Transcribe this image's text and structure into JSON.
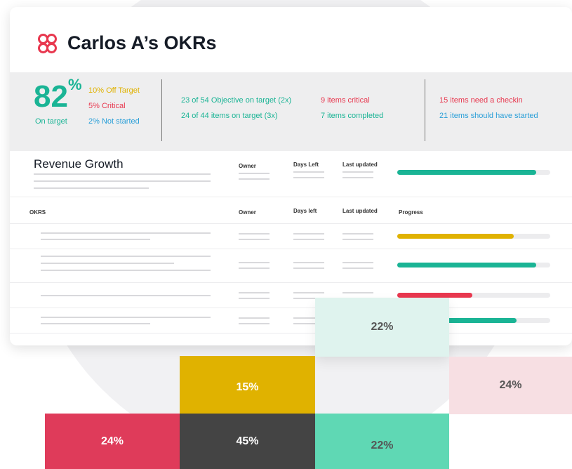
{
  "header": {
    "title": "Carlos A’s OKRs"
  },
  "summary": {
    "percent": "82",
    "percent_sign": "%",
    "on_target_label": "On target",
    "off_target": "10% Off Target",
    "critical": "5% Critical",
    "not_started": "2% Not started",
    "objectives_line": "23 of 54 Objective on target (2x)",
    "items_line": "24 of 44 items on target (3x)",
    "items_critical": "9 items critical",
    "items_completed": "7 items completed",
    "need_checkin": "15 items need a checkin",
    "should_started": "21  items should have started"
  },
  "section": {
    "title": "Revenue Growth",
    "owner": "Owner",
    "days_left": "Days Left",
    "last_updated": "Last updated",
    "progress": 0.91
  },
  "table": {
    "headers": {
      "okrs": "OKRS",
      "owner": "Owner",
      "days_left": "Days left",
      "last_updated": "Last updated",
      "progress": "Progress"
    },
    "rows": [
      {
        "progress": 0.76,
        "color": "#e0b200"
      },
      {
        "progress": 0.91,
        "color": "#1ab495"
      },
      {
        "progress": 0.49,
        "color": "#e8384f"
      },
      {
        "progress": 0.78,
        "color": "#1ab495"
      }
    ]
  },
  "tiles": {
    "mint_top": "22%",
    "yellow": "15%",
    "pink": "24%",
    "red": "24%",
    "dark": "45%",
    "green": "22%"
  },
  "colors": {
    "teal": "#1ab495",
    "yellow": "#e0b200",
    "red": "#e8384f",
    "blue": "#2a9fd8",
    "tile_red": "#df3b5a",
    "tile_dark": "#444444",
    "tile_green": "#5fd8b4",
    "tile_mint": "#dff3ee",
    "tile_pink": "#f7dfe3"
  }
}
